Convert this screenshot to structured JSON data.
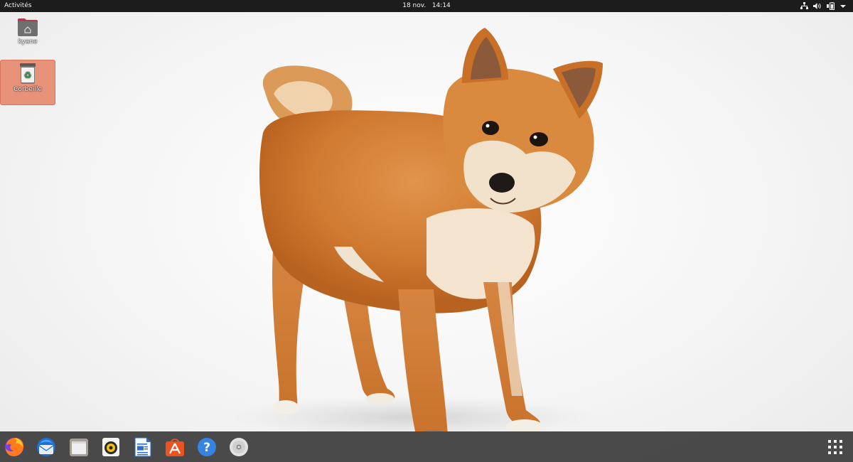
{
  "topbar": {
    "activities_label": "Activités",
    "date": "18 nov.",
    "time": "14:14"
  },
  "tray": {
    "icons": [
      "network-icon",
      "volume-icon",
      "battery-icon",
      "chevron-down-icon"
    ]
  },
  "desktop": {
    "icons": [
      {
        "label": "kyane",
        "icon": "home-folder-icon"
      },
      {
        "label": "Corbeille",
        "icon": "trash-icon"
      }
    ]
  },
  "dock": {
    "apps": [
      {
        "name": "Firefox",
        "icon": "firefox-icon"
      },
      {
        "name": "Thunderbird",
        "icon": "thunderbird-icon"
      },
      {
        "name": "Fichiers",
        "icon": "files-icon"
      },
      {
        "name": "Rhythmbox",
        "icon": "rhythmbox-icon"
      },
      {
        "name": "LibreOffice Writer",
        "icon": "writer-icon"
      },
      {
        "name": "Ubuntu Software",
        "icon": "software-center-icon"
      },
      {
        "name": "Aide",
        "icon": "help-icon"
      },
      {
        "name": "Disque",
        "icon": "disc-icon"
      }
    ],
    "show_apps_icon": "apps-grid-icon"
  },
  "colors": {
    "topbar_bg": "#1c1c1c",
    "dock_bg": "#323232",
    "selection": "#e8927a",
    "ubuntu_orange": "#e95420"
  }
}
